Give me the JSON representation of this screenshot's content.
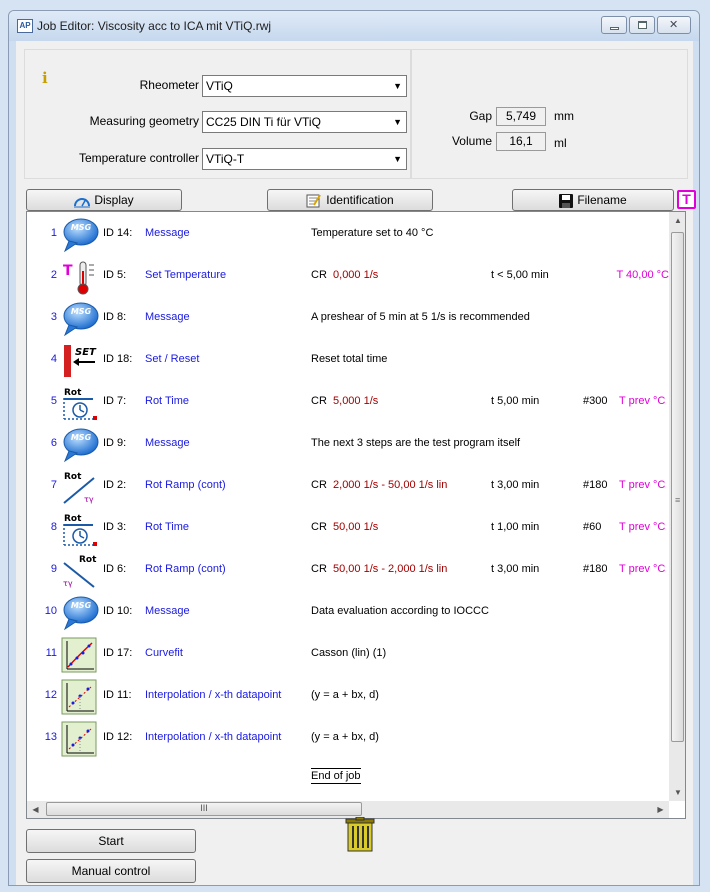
{
  "window": {
    "title": "Job Editor: Viscosity acc to ICA mit VTiQ.rwj"
  },
  "config": {
    "rheometer_label": "Rheometer",
    "rheometer_value": "VTiQ",
    "geometry_label": "Measuring geometry",
    "geometry_value": "CC25 DIN Ti für VTiQ",
    "temp_label": "Temperature controller",
    "temp_value": "VTiQ-T"
  },
  "measure": {
    "gap_label": "Gap",
    "gap_value": "5,749",
    "gap_unit": "mm",
    "volume_label": "Volume",
    "volume_value": "16,1",
    "volume_unit": "ml"
  },
  "toolbar": {
    "display": "Display",
    "identification": "Identification",
    "filename": "Filename",
    "t_button": "T"
  },
  "steps": [
    {
      "num": "1",
      "icon": "message-icon",
      "id": "ID 14:",
      "name": "Message",
      "desc": "Temperature set to 40 °C"
    },
    {
      "num": "2",
      "icon": "thermometer-icon",
      "id": "ID 5:",
      "name": "Set Temperature",
      "desc_prefix": "CR",
      "desc_value": "0,000 1/s",
      "time": "t < 5,00 min",
      "temp": "T 40,00 °C"
    },
    {
      "num": "3",
      "icon": "message-icon",
      "id": "ID 8:",
      "name": "Message",
      "desc": "A preshear of 5 min at 5 1/s is recommended"
    },
    {
      "num": "4",
      "icon": "set-reset-icon",
      "id": "ID 18:",
      "name": "Set / Reset",
      "desc": "Reset total time"
    },
    {
      "num": "5",
      "icon": "rot-time-icon",
      "id": "ID 7:",
      "name": "Rot Time",
      "desc_prefix": "CR",
      "desc_value": "5,000 1/s",
      "time": "t 5,00 min",
      "count": "#300",
      "temp": "T prev °C"
    },
    {
      "num": "6",
      "icon": "message-icon",
      "id": "ID 9:",
      "name": "Message",
      "desc": "The next 3 steps are the test program itself"
    },
    {
      "num": "7",
      "icon": "rot-ramp-up-icon",
      "id": "ID 2:",
      "name": "Rot Ramp (cont)",
      "desc_prefix": "CR",
      "desc_value": "2,000 1/s - 50,00 1/s lin",
      "time": "t 3,00 min",
      "count": "#180",
      "temp": "T prev °C"
    },
    {
      "num": "8",
      "icon": "rot-time-icon",
      "id": "ID 3:",
      "name": "Rot Time",
      "desc_prefix": "CR",
      "desc_value": "50,00 1/s",
      "time": "t 1,00 min",
      "count": "#60",
      "temp": "T prev °C"
    },
    {
      "num": "9",
      "icon": "rot-ramp-down-icon",
      "id": "ID 6:",
      "name": "Rot Ramp (cont)",
      "desc_prefix": "CR",
      "desc_value": "50,00 1/s - 2,000 1/s lin",
      "time": "t 3,00 min",
      "count": "#180",
      "temp": "T prev °C"
    },
    {
      "num": "10",
      "icon": "message-icon",
      "id": "ID 10:",
      "name": "Message",
      "desc": "Data evaluation according to IOCCC"
    },
    {
      "num": "11",
      "icon": "curvefit-icon",
      "id": "ID 17:",
      "name": "Curvefit",
      "desc": "Casson (lin) (1)"
    },
    {
      "num": "12",
      "icon": "interpolation-icon",
      "id": "ID 11:",
      "name": "Interpolation / x-th datapoint",
      "desc": "(y = a + bx, d)"
    },
    {
      "num": "13",
      "icon": "interpolation-icon",
      "id": "ID 12:",
      "name": "Interpolation / x-th datapoint",
      "desc": "(y = a + bx, d)"
    }
  ],
  "end_of_job": "End of job",
  "bottom": {
    "start": "Start",
    "manual": "Manual control"
  }
}
